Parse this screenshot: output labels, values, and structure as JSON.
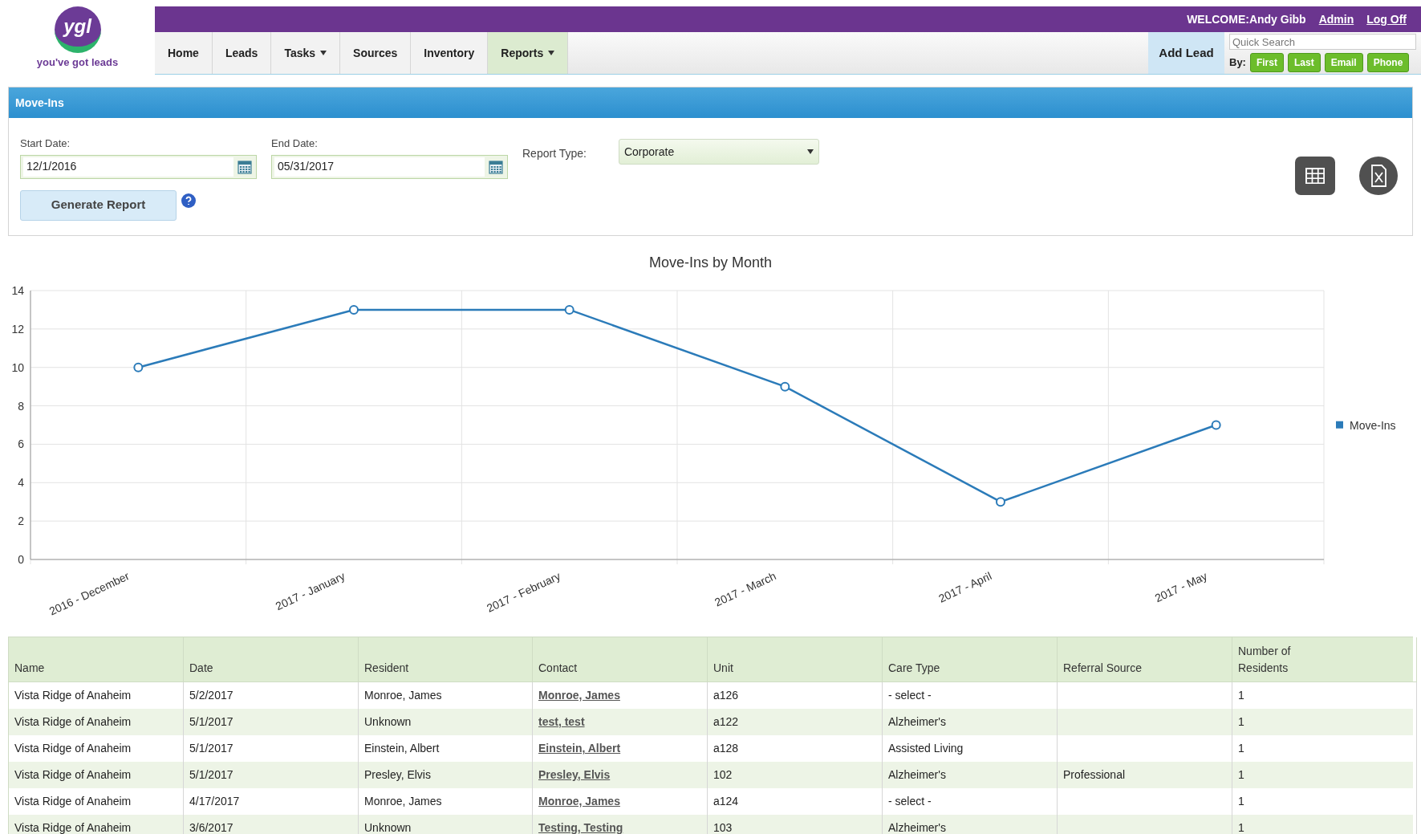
{
  "logo": {
    "mark": "ygl",
    "tagline": "you've got leads"
  },
  "top_bar": {
    "welcome": "WELCOME:Andy Gibb",
    "links": [
      "Admin",
      "Log Off"
    ]
  },
  "nav": [
    {
      "label": "Home",
      "selected": false,
      "dropdown": false
    },
    {
      "label": "Leads",
      "selected": false,
      "dropdown": false
    },
    {
      "label": "Tasks",
      "selected": false,
      "dropdown": true
    },
    {
      "label": "Sources",
      "selected": false,
      "dropdown": false
    },
    {
      "label": "Inventory",
      "selected": false,
      "dropdown": false
    },
    {
      "label": "Reports",
      "selected": true,
      "dropdown": true
    }
  ],
  "add_lead": "Add Lead",
  "quick_search": {
    "placeholder": "Quick Search",
    "by_label": "By:",
    "buttons": [
      "First",
      "Last",
      "Email",
      "Phone"
    ]
  },
  "panel": {
    "title": "Move-Ins",
    "start_date": {
      "label": "Start Date:",
      "value": "12/1/2016"
    },
    "end_date": {
      "label": "End Date:",
      "value": "05/31/2017"
    },
    "report_type": {
      "label": "Report Type:",
      "value": "Corporate"
    },
    "generate_button": "Generate Report"
  },
  "chart": {
    "chart_data": {
      "type": "line",
      "title": "Move-Ins by Month",
      "categories": [
        "2016 - December",
        "2017 - January",
        "2017 - February",
        "2017 - March",
        "2017 - April",
        "2017 - May"
      ],
      "series": [
        {
          "name": "Move-Ins",
          "color": "#2b7bb9",
          "values": [
            10,
            13,
            13,
            9,
            3,
            7
          ]
        }
      ],
      "grid": true,
      "marker": true,
      "ylim": [
        0,
        14
      ],
      "yticks": [
        0,
        2,
        4,
        6,
        8,
        10,
        12,
        14
      ]
    }
  },
  "table": {
    "columns": [
      "Name",
      "Date",
      "Resident",
      "Contact",
      "Unit",
      "Care Type",
      "Referral Source",
      "Number of Residents"
    ],
    "rows": [
      {
        "cells": [
          "Vista Ridge of Anaheim",
          "5/2/2017",
          "Monroe, James",
          "Monroe, James",
          "a126",
          "- select -",
          "",
          "1"
        ]
      },
      {
        "cells": [
          "Vista Ridge of Anaheim",
          "5/1/2017",
          "Unknown",
          "test, test",
          "a122",
          "Alzheimer's",
          "",
          "1"
        ]
      },
      {
        "cells": [
          "Vista Ridge of Anaheim",
          "5/1/2017",
          "Einstein, Albert",
          "Einstein, Albert",
          "a128",
          "Assisted Living",
          "",
          "1"
        ]
      },
      {
        "cells": [
          "Vista Ridge of Anaheim",
          "5/1/2017",
          "Presley, Elvis",
          "Presley, Elvis",
          "102",
          "Alzheimer's",
          "Professional",
          "1"
        ]
      },
      {
        "cells": [
          "Vista Ridge of Anaheim",
          "4/17/2017",
          "Monroe, James",
          "Monroe, James",
          "a124",
          "- select -",
          "",
          "1"
        ]
      },
      {
        "cells": [
          "Vista Ridge of Anaheim",
          "3/6/2017",
          "Unknown",
          "Testing, Testing",
          "103",
          "Alzheimer's",
          "",
          "1"
        ]
      }
    ]
  }
}
